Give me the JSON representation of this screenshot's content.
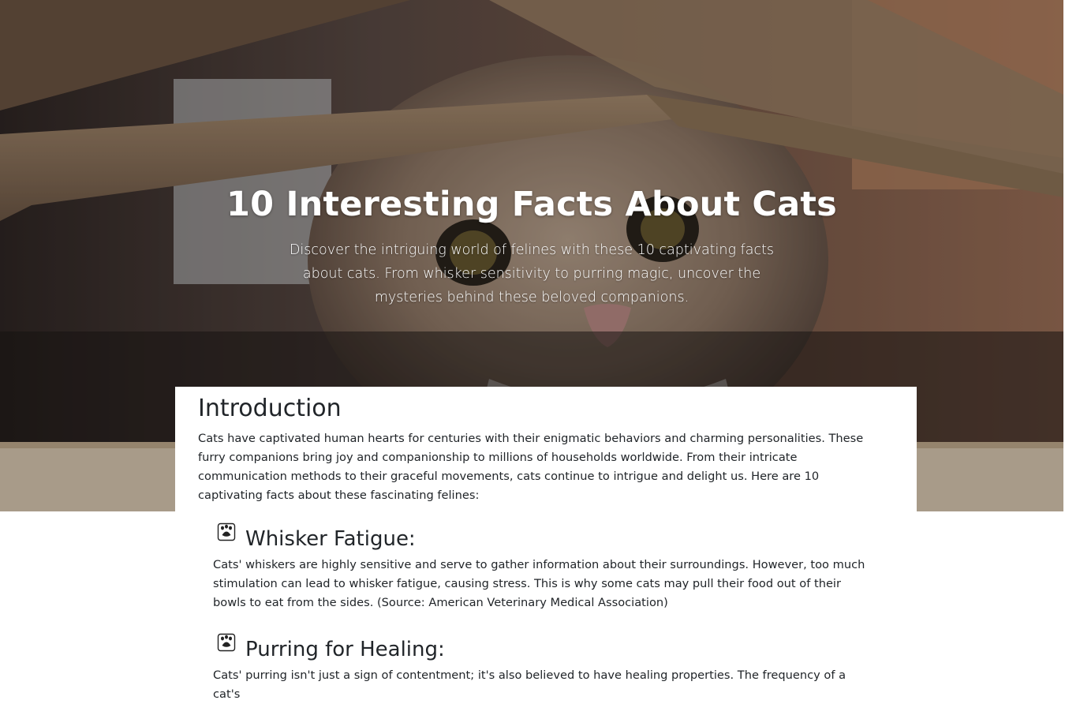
{
  "hero": {
    "title": "10 Interesting Facts About Cats",
    "subtitle": "Discover the intriguing world of felines with these 10 captivating facts about cats. From whisker sensitivity to purring magic, uncover the mysteries behind these beloved companions."
  },
  "intro": {
    "heading": "Introduction",
    "text": "Cats have captivated human hearts for centuries with their enigmatic behaviors and charming personalities. These furry companions bring joy and companionship to millions of households worldwide. From their intricate communication methods to their graceful movements, cats continue to intrigue and delight us. Here are 10 captivating facts about these fascinating felines:"
  },
  "facts": [
    {
      "icon": "paw-icon",
      "title": "Whisker Fatigue:",
      "text": "Cats' whiskers are highly sensitive and serve to gather information about their surroundings. However, too much stimulation can lead to whisker fatigue, causing stress. This is why some cats may pull their food out of their bowls to eat from the sides. (Source: American Veterinary Medical Association)"
    },
    {
      "icon": "paw-icon",
      "title": "Purring for Healing:",
      "text": "Cats' purring isn't just a sign of contentment; it's also believed to have healing properties. The frequency of a cat's"
    }
  ]
}
